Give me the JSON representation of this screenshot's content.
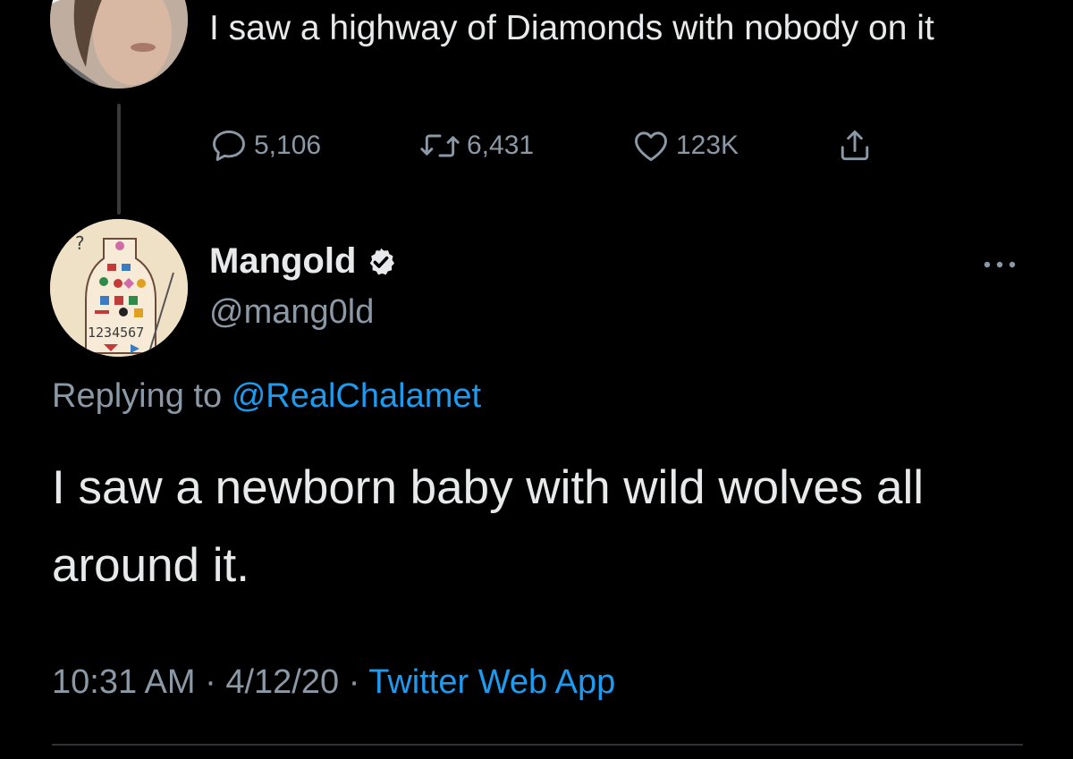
{
  "parent_tweet": {
    "text": "I saw a highway of Diamonds with nobody on it",
    "replies_count": "5,106",
    "retweets_count": "6,431",
    "likes_count": "123K"
  },
  "reply_tweet": {
    "author_name": "Mangold",
    "author_handle": "@mang0ld",
    "replying_to_prefix": "Replying to",
    "replying_to_handle": "@RealChalamet",
    "text": "I saw a newborn baby with wild wolves all around it.",
    "time": "10:31 AM",
    "date": "4/12/20",
    "source": "Twitter Web App",
    "separator": "·"
  },
  "colors": {
    "background": "#000000",
    "text_primary": "#e7e9ea",
    "text_secondary": "#8b98a5",
    "link": "#1d9bf0",
    "divider": "#2f3336"
  },
  "icons": {
    "reply": "speech-bubble-icon",
    "retweet": "retweet-arrows-icon",
    "like": "heart-icon",
    "share": "share-upload-icon",
    "verified": "verified-badge-icon",
    "more": "more-dots-icon"
  }
}
